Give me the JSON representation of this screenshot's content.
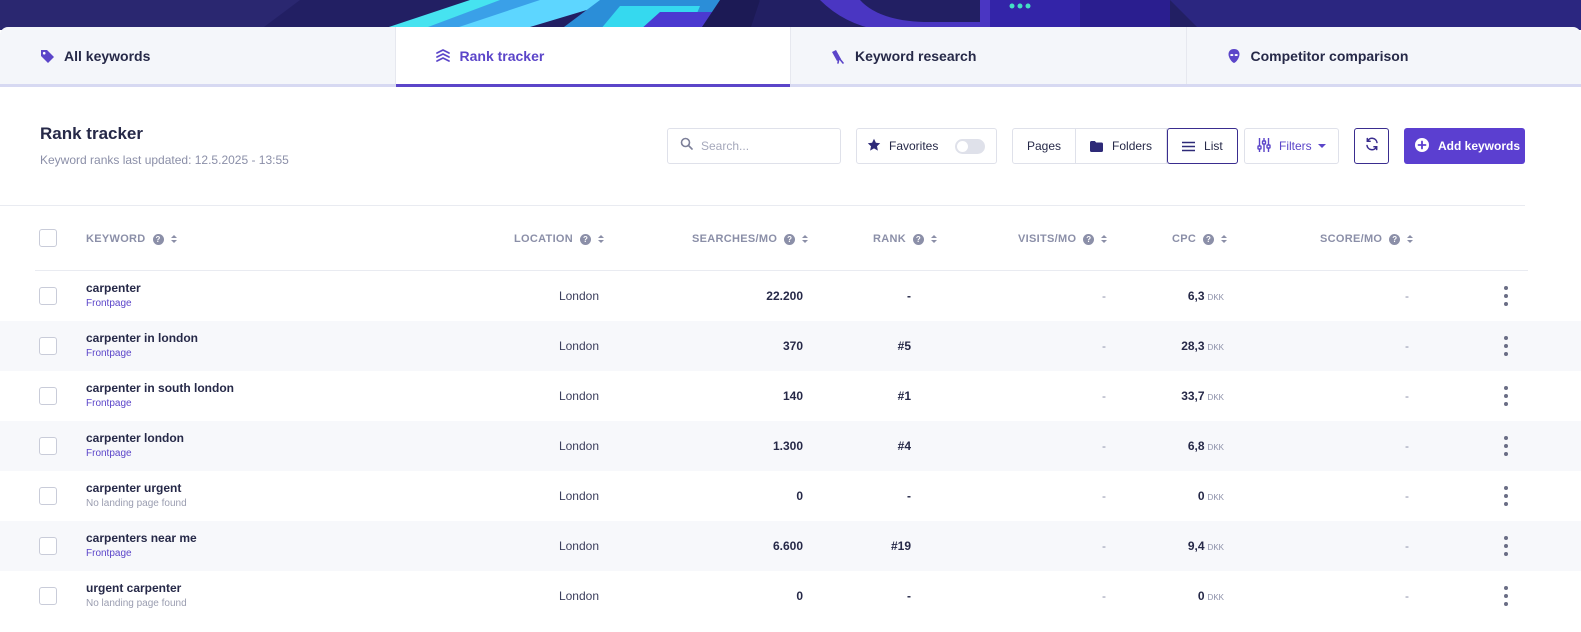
{
  "colors": {
    "accent": "#5b45c9",
    "button": "#5b3fd0",
    "text": "#262948",
    "muted": "#8b8fa8"
  },
  "tabs": [
    {
      "label": "All keywords",
      "icon": "tag-icon"
    },
    {
      "label": "Rank tracker",
      "icon": "layers-icon",
      "active": true
    },
    {
      "label": "Keyword research",
      "icon": "telescope-icon"
    },
    {
      "label": "Competitor comparison",
      "icon": "alien-head-icon"
    }
  ],
  "header": {
    "title": "Rank tracker",
    "subtitle": "Keyword ranks last updated: 12.5.2025 - 13:55"
  },
  "toolbar": {
    "search_placeholder": "Search...",
    "favorites_label": "Favorites",
    "favorites_on": false,
    "views": {
      "pages": "Pages",
      "folders": "Folders",
      "list": "List",
      "selected": "List"
    },
    "filters_label": "Filters",
    "add_label": "Add keywords"
  },
  "table": {
    "columns": {
      "keyword": "KEYWORD",
      "location": "LOCATION",
      "searches": "SEARCHES/MO",
      "rank": "RANK",
      "visits": "VISITS/MO",
      "cpc": "CPC",
      "score": "SCORE/MO"
    },
    "currency": "DKK",
    "rows": [
      {
        "keyword": "carpenter",
        "landing": "Frontpage",
        "location": "London",
        "searches": "22.200",
        "rank": "-",
        "visits": "-",
        "cpc": "6,3",
        "score": "-"
      },
      {
        "keyword": "carpenter in london",
        "landing": "Frontpage",
        "location": "London",
        "searches": "370",
        "rank": "#5",
        "visits": "-",
        "cpc": "28,3",
        "score": "-"
      },
      {
        "keyword": "carpenter in south london",
        "landing": "Frontpage",
        "location": "London",
        "searches": "140",
        "rank": "#1",
        "visits": "-",
        "cpc": "33,7",
        "score": "-"
      },
      {
        "keyword": "carpenter london",
        "landing": "Frontpage",
        "location": "London",
        "searches": "1.300",
        "rank": "#4",
        "visits": "-",
        "cpc": "6,8",
        "score": "-"
      },
      {
        "keyword": "carpenter urgent",
        "landing": "No landing page found",
        "location": "London",
        "searches": "0",
        "rank": "-",
        "visits": "-",
        "cpc": "0",
        "score": "-"
      },
      {
        "keyword": "carpenters near me",
        "landing": "Frontpage",
        "location": "London",
        "searches": "6.600",
        "rank": "#19",
        "visits": "-",
        "cpc": "9,4",
        "score": "-"
      },
      {
        "keyword": "urgent carpenter",
        "landing": "No landing page found",
        "location": "London",
        "searches": "0",
        "rank": "-",
        "visits": "-",
        "cpc": "0",
        "score": "-"
      }
    ]
  }
}
